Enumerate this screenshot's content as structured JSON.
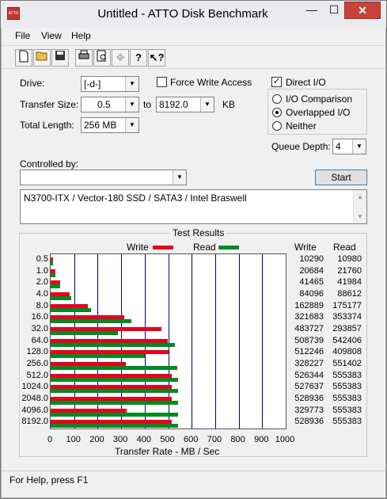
{
  "window": {
    "title": "Untitled - ATTO Disk Benchmark",
    "icon_text": "ATTO",
    "min": "—",
    "max": "☐",
    "close": "✕"
  },
  "menu": [
    "File",
    "View",
    "Help"
  ],
  "toolbar": [
    "new-icon",
    "open-icon",
    "save-icon",
    "print-icon",
    "print-preview-icon",
    "move-icon",
    "help-icon",
    "context-help-icon"
  ],
  "form": {
    "drive_label": "Drive:",
    "drive_value": "[-d-]",
    "force_write_label": "Force Write Access",
    "force_write_checked": false,
    "direct_io_label": "Direct I/O",
    "direct_io_checked": true,
    "transfer_label": "Transfer Size:",
    "transfer_from": "0.5",
    "to_label": "to",
    "transfer_to": "8192.0",
    "kb_label": "KB",
    "io_comparison_label": "I/O Comparison",
    "overlapped_io_label": "Overlapped I/O",
    "neither_label": "Neither",
    "selected_io": "Overlapped I/O",
    "total_length_label": "Total Length:",
    "total_length_value": "256 MB",
    "queue_depth_label": "Queue Depth:",
    "queue_depth_value": "4",
    "controlled_by_label": "Controlled by:",
    "controlled_by_value": "",
    "start_label": "Start",
    "description": "N3700-ITX / Vector-180 SSD / SATA3 / Intel Braswell"
  },
  "status": {
    "text": "For Help, press F1"
  },
  "colors": {
    "write": "#e8001c",
    "read": "#008a21",
    "grid": "#00008b"
  },
  "chart_data": {
    "type": "bar",
    "title": "Test Results",
    "xlabel": "Transfer Rate - MB / Sec",
    "xlim": [
      0,
      1000
    ],
    "xticks": [
      "0",
      "100",
      "200",
      "300",
      "400",
      "500",
      "600",
      "700",
      "800",
      "900",
      "1000"
    ],
    "legend": [
      "Write",
      "Read"
    ],
    "columns": [
      "Write",
      "Read"
    ],
    "categories": [
      "0.5",
      "1.0",
      "2.0",
      "4.0",
      "8.0",
      "16.0",
      "32.0",
      "64.0",
      "128.0",
      "256.0",
      "512.0",
      "1024.0",
      "2048.0",
      "4096.0",
      "8192.0"
    ],
    "series": [
      {
        "name": "Write",
        "values": [
          10290,
          20684,
          41465,
          84096,
          162889,
          321683,
          483727,
          508739,
          512246,
          328227,
          526344,
          527637,
          528936,
          329773,
          528936
        ]
      },
      {
        "name": "Read",
        "values": [
          10980,
          21760,
          41984,
          88612,
          175177,
          353374,
          293857,
          542406,
          409808,
          551402,
          555383,
          555383,
          555383,
          555383,
          555383
        ]
      }
    ]
  }
}
